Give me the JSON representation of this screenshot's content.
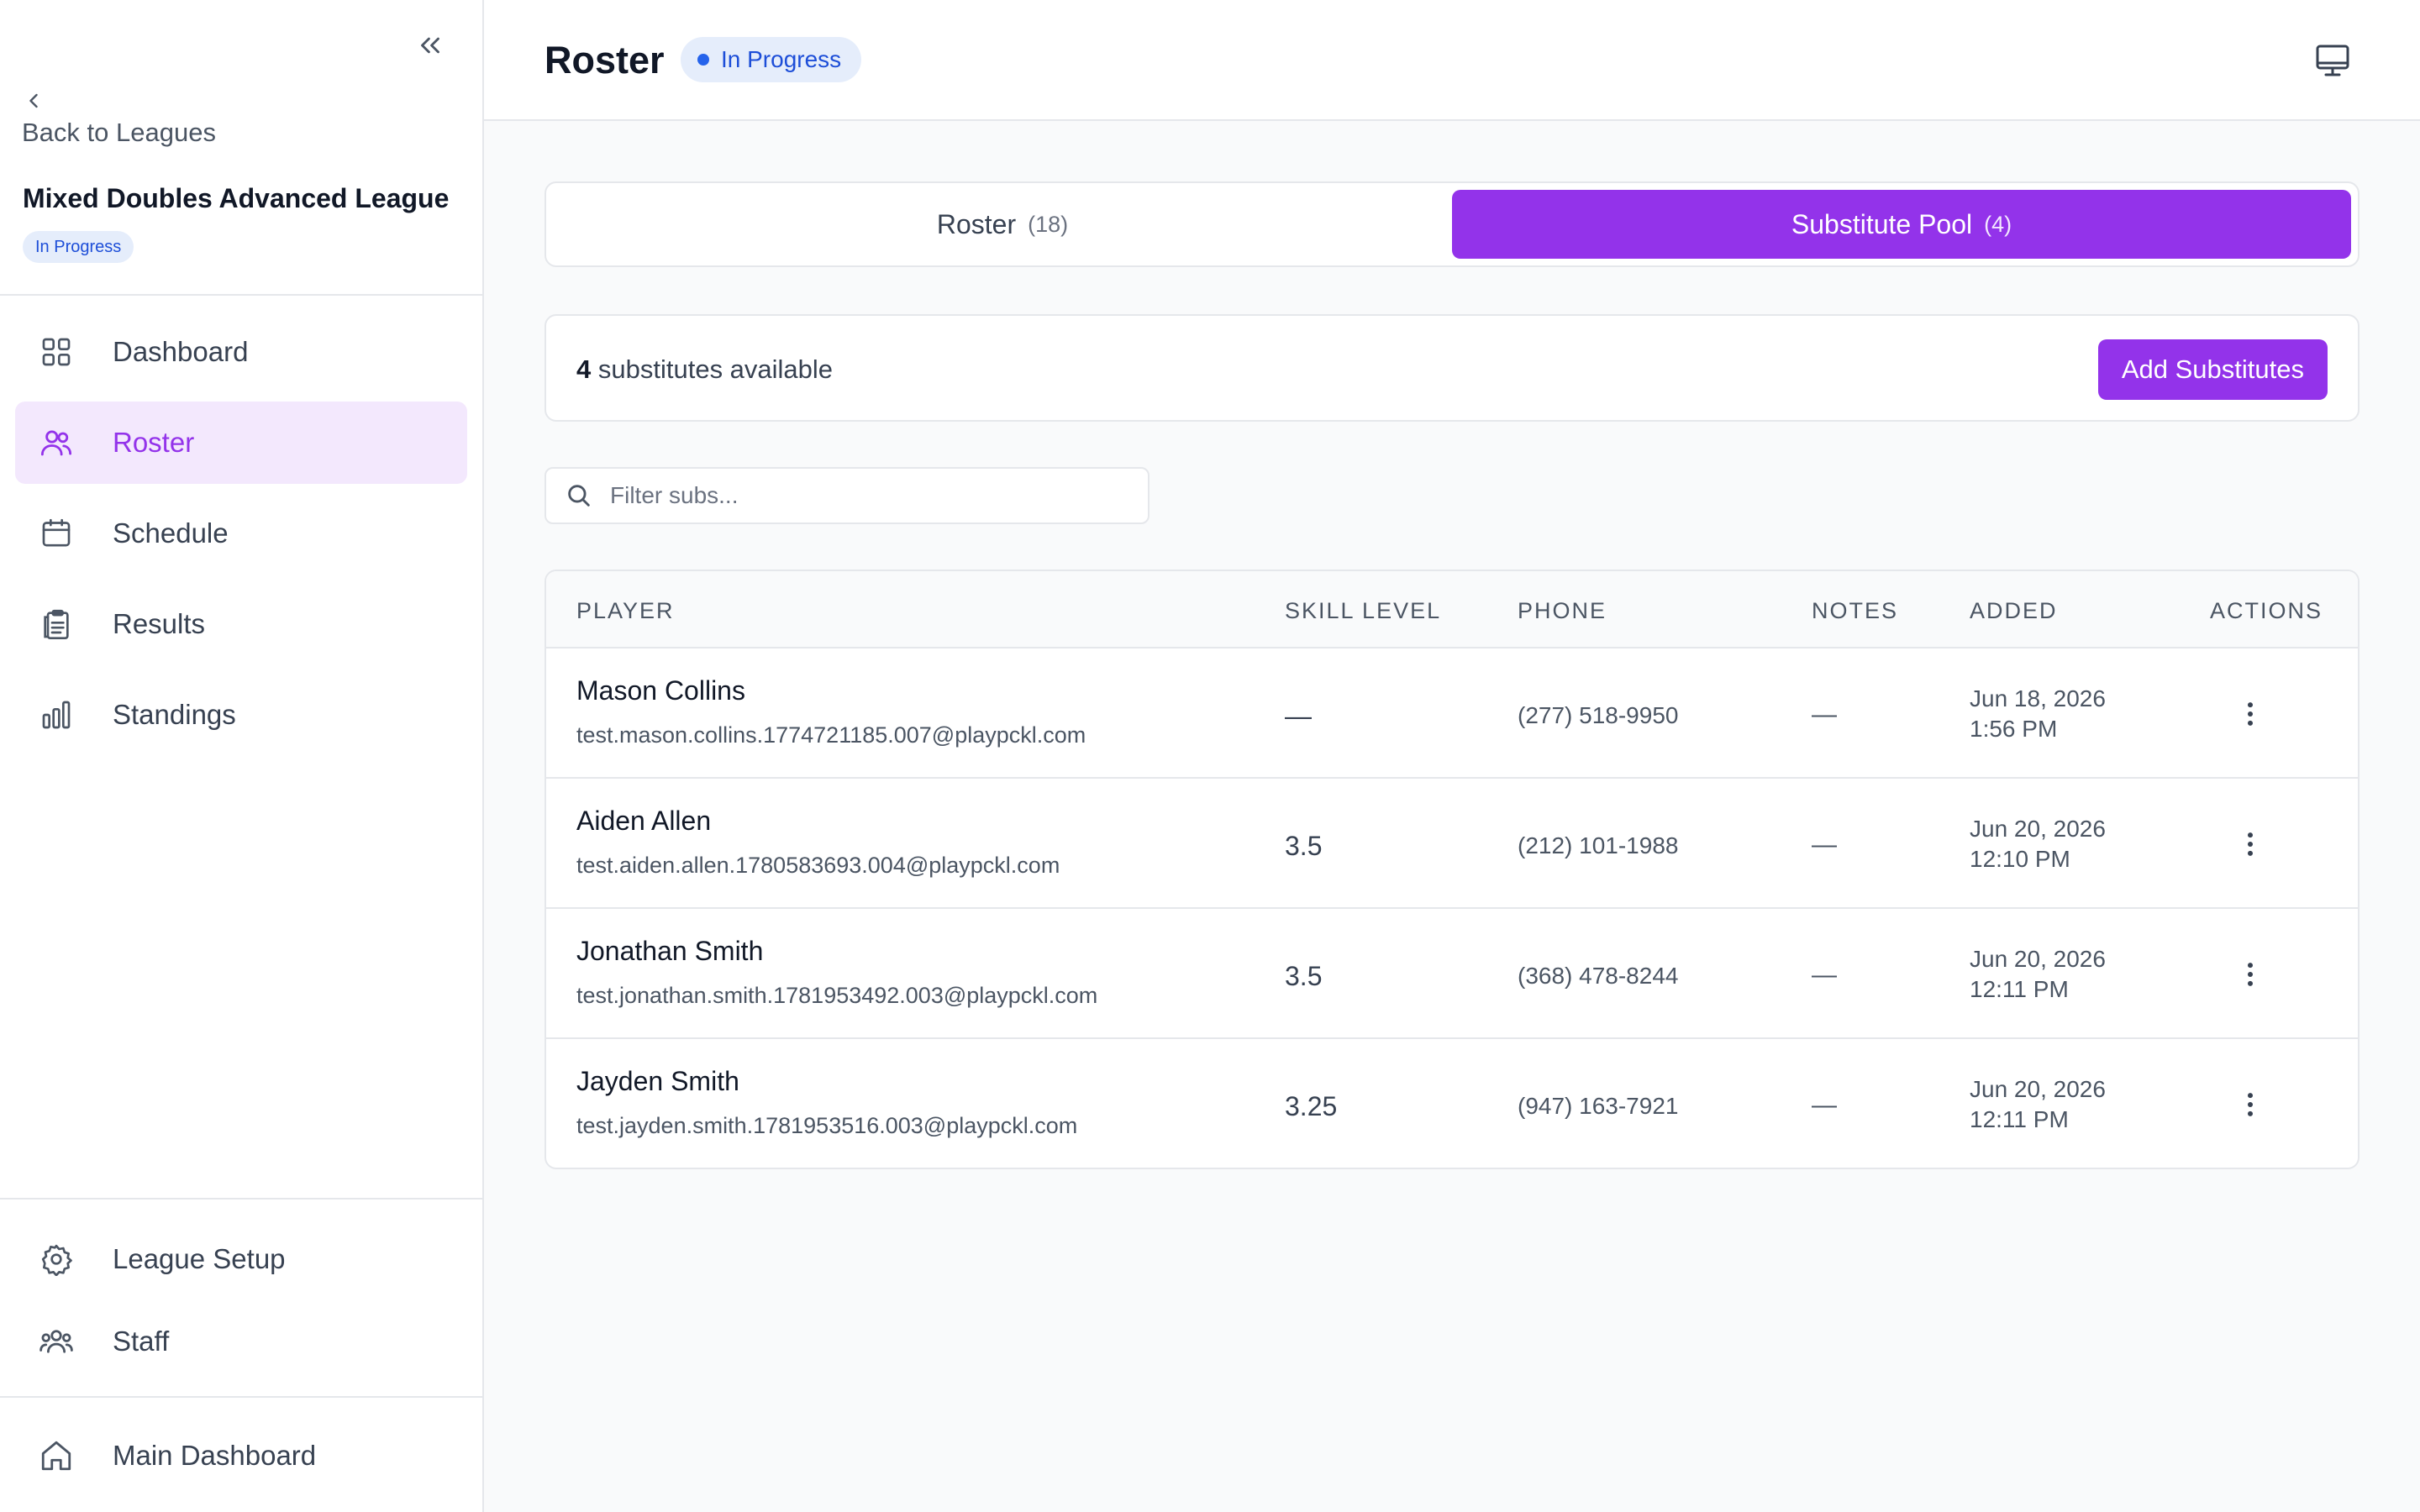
{
  "sidebar": {
    "back_label": "Back to Leagues",
    "league_name": "Mixed Doubles Advanced League",
    "status_badge": "In Progress",
    "nav": [
      {
        "label": "Dashboard",
        "icon": "grid-icon"
      },
      {
        "label": "Roster",
        "icon": "users-icon",
        "active": true
      },
      {
        "label": "Schedule",
        "icon": "calendar-icon"
      },
      {
        "label": "Results",
        "icon": "clipboard-icon"
      },
      {
        "label": "Standings",
        "icon": "bar-chart-icon"
      }
    ],
    "bottom_nav": [
      {
        "label": "League Setup",
        "icon": "gear-icon"
      },
      {
        "label": "Staff",
        "icon": "team-icon"
      }
    ],
    "footer_nav": {
      "label": "Main Dashboard",
      "icon": "home-icon"
    }
  },
  "header": {
    "title": "Roster",
    "status": "In Progress"
  },
  "tabs": [
    {
      "label": "Roster",
      "count": "(18)"
    },
    {
      "label": "Substitute Pool",
      "count": "(4)",
      "active": true
    }
  ],
  "summary": {
    "count": "4",
    "text": "substitutes available",
    "add_button": "Add Substitutes"
  },
  "filter": {
    "placeholder": "Filter subs..."
  },
  "table": {
    "headers": {
      "player": "PLAYER",
      "skill": "SKILL LEVEL",
      "phone": "PHONE",
      "notes": "NOTES",
      "added": "ADDED",
      "actions": "ACTIONS"
    },
    "rows": [
      {
        "name": "Mason Collins",
        "email": "test.mason.collins.1774721185.007@playpckl.com",
        "skill": "—",
        "phone": "(277) 518-9950",
        "notes": "—",
        "date": "Jun 18, 2026",
        "time": "1:56 PM"
      },
      {
        "name": "Aiden Allen",
        "email": "test.aiden.allen.1780583693.004@playpckl.com",
        "skill": "3.5",
        "phone": "(212) 101-1988",
        "notes": "—",
        "date": "Jun 20, 2026",
        "time": "12:10 PM"
      },
      {
        "name": "Jonathan Smith",
        "email": "test.jonathan.smith.1781953492.003@playpckl.com",
        "skill": "3.5",
        "phone": "(368) 478-8244",
        "notes": "—",
        "date": "Jun 20, 2026",
        "time": "12:11 PM"
      },
      {
        "name": "Jayden Smith",
        "email": "test.jayden.smith.1781953516.003@playpckl.com",
        "skill": "3.25",
        "phone": "(947) 163-7921",
        "notes": "—",
        "date": "Jun 20, 2026",
        "time": "12:11 PM"
      }
    ]
  },
  "colors": {
    "accent": "#9333ea",
    "accent_light": "#f3e8fd",
    "status_blue": "#1d4ed8",
    "status_bg": "#e5edfb"
  }
}
